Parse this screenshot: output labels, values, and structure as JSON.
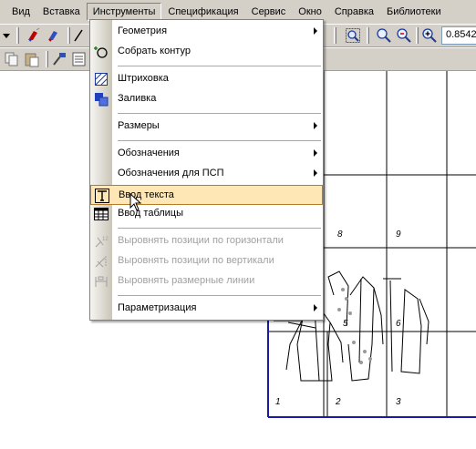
{
  "menubar": {
    "items": [
      {
        "label": "Вид"
      },
      {
        "label": "Вставка"
      },
      {
        "label": "Инструменты"
      },
      {
        "label": "Спецификация"
      },
      {
        "label": "Сервис"
      },
      {
        "label": "Окно"
      },
      {
        "label": "Справка"
      },
      {
        "label": "Библиотеки"
      }
    ]
  },
  "toolbar": {
    "zoom_value": "0.8542"
  },
  "dropdown": {
    "items": [
      {
        "label": "Геометрия",
        "icon": "none",
        "submenu": true
      },
      {
        "label": "Собрать контур",
        "icon": "collect-contour-icon"
      },
      {
        "label": "Штриховка",
        "icon": "hatching-icon"
      },
      {
        "label": "Заливка",
        "icon": "fill-icon"
      },
      {
        "label": "Размеры",
        "submenu": true
      },
      {
        "label": "Обозначения",
        "submenu": true
      },
      {
        "label": "Обозначения для ПСП",
        "submenu": true
      },
      {
        "label": "Ввод текста",
        "icon": "text-input-icon",
        "highlighted": true
      },
      {
        "label": "Ввод таблицы",
        "icon": "table-input-icon"
      },
      {
        "label": "Выровнять позиции по горизонтали",
        "icon": "align-horizontal-icon",
        "disabled": true
      },
      {
        "label": "Выровнять позиции по вертикали",
        "icon": "align-vertical-icon",
        "disabled": true
      },
      {
        "label": "Выровнять размерные линии",
        "icon": "align-dimension-lines-icon",
        "disabled": true
      },
      {
        "label": "Параметризация",
        "submenu": true
      }
    ]
  },
  "drawing": {
    "cell_labels": [
      "8",
      "9",
      "5",
      "6",
      "1",
      "2",
      "3"
    ],
    "frame_color": "#1a1aa6"
  }
}
